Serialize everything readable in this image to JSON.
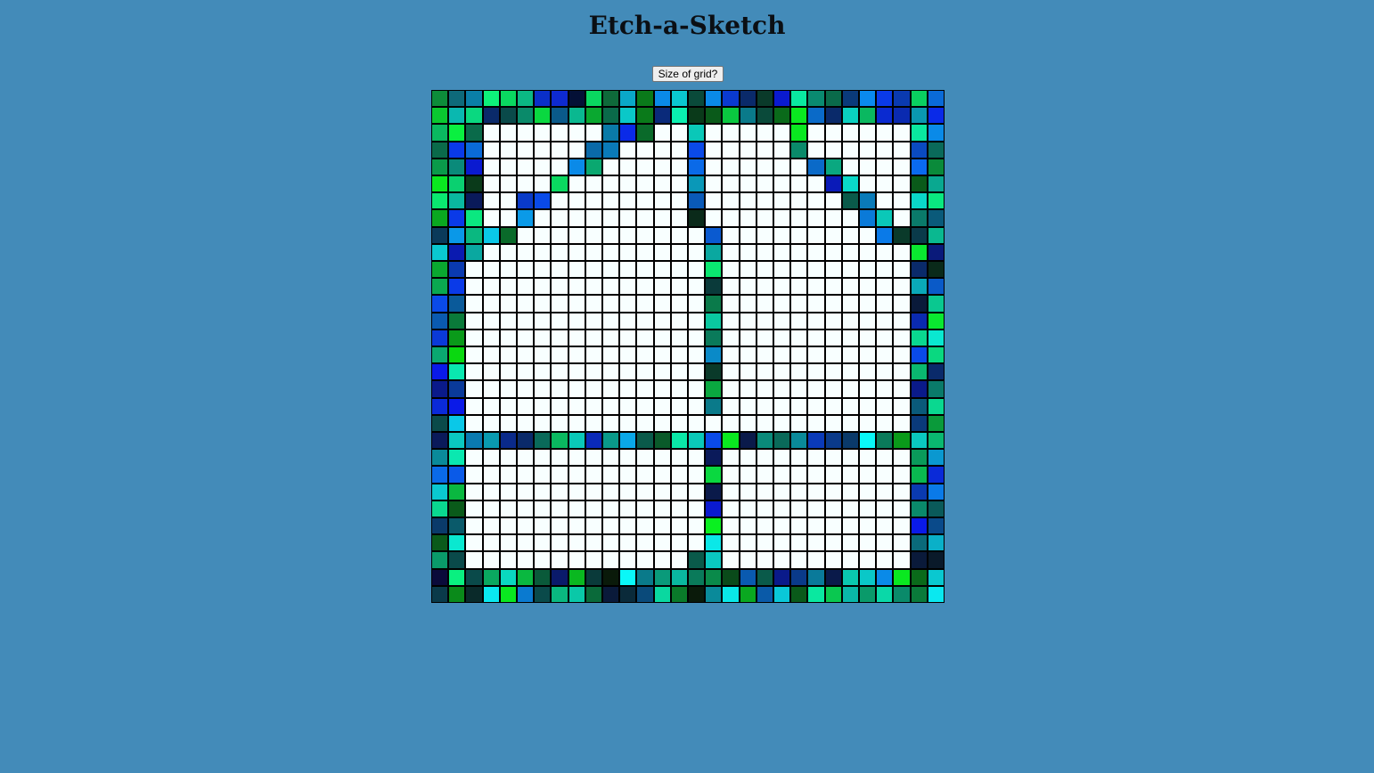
{
  "title": "Etch-a-Sketch",
  "controls": {
    "size_button_label": "Size of grid?"
  },
  "grid": {
    "size": 30,
    "blank_color": "#f8ffff",
    "colored_cells": {
      "0": [
        [
          0,
          "#0d8c3a"
        ],
        [
          1,
          "#0e6a7a"
        ],
        [
          2,
          "#0a7fa8"
        ],
        [
          3,
          "#0ef07a"
        ],
        [
          4,
          "#0ad860"
        ],
        [
          5,
          "#0bb884"
        ],
        [
          6,
          "#0a2fc8"
        ],
        [
          7,
          "#0e2ad0"
        ],
        [
          8,
          "#041036"
        ],
        [
          9,
          "#0ad860"
        ],
        [
          10,
          "#0e6a3a"
        ],
        [
          11,
          "#0aa8c8"
        ],
        [
          12,
          "#0a7a1a"
        ],
        [
          13,
          "#0a8ae8"
        ],
        [
          14,
          "#0ac8d0"
        ],
        [
          15,
          "#0a4a3a"
        ],
        [
          16,
          "#0a8ae8"
        ],
        [
          17,
          "#0a3ad0"
        ],
        [
          18,
          "#0a2a6a"
        ],
        [
          19,
          "#0a3a2a"
        ],
        [
          20,
          "#0a1ad0"
        ],
        [
          21,
          "#0ae8a0"
        ],
        [
          22,
          "#0a8a70"
        ],
        [
          23,
          "#0a6a4a"
        ],
        [
          24,
          "#0a3a7a"
        ],
        [
          25,
          "#0a8aee"
        ],
        [
          26,
          "#0a3ae8"
        ],
        [
          27,
          "#0a3ab0"
        ],
        [
          28,
          "#0ad060"
        ],
        [
          29,
          "#0a6ad8"
        ]
      ],
      "1": [
        [
          0,
          "#0ac830"
        ],
        [
          1,
          "#0ab8b0"
        ],
        [
          2,
          "#0ad880"
        ],
        [
          3,
          "#0a2a6a"
        ],
        [
          4,
          "#0a4a4a"
        ],
        [
          5,
          "#0a8a6a"
        ],
        [
          6,
          "#0ad840"
        ],
        [
          7,
          "#0a5a8a"
        ],
        [
          8,
          "#0ab890"
        ],
        [
          9,
          "#0aa830"
        ],
        [
          10,
          "#0a6a4a"
        ],
        [
          11,
          "#0ac8c8"
        ],
        [
          12,
          "#0a7a1a"
        ],
        [
          13,
          "#0a2a7a"
        ],
        [
          14,
          "#0af0b0"
        ],
        [
          15,
          "#0a3a1a"
        ],
        [
          16,
          "#0a5a1a"
        ],
        [
          17,
          "#0ac840"
        ],
        [
          18,
          "#0a7a8a"
        ],
        [
          19,
          "#0a4a3a"
        ],
        [
          20,
          "#0a6a1a"
        ],
        [
          21,
          "#0ae820"
        ],
        [
          22,
          "#0a6ac8"
        ],
        [
          23,
          "#0a2a6a"
        ],
        [
          24,
          "#0ad0c0"
        ],
        [
          25,
          "#0ab860"
        ],
        [
          26,
          "#0a2ad0"
        ],
        [
          27,
          "#0a2ab0"
        ],
        [
          28,
          "#0a98b0"
        ],
        [
          29,
          "#0a2ae8"
        ]
      ],
      "2": [
        [
          0,
          "#0ab860"
        ],
        [
          1,
          "#0af040"
        ],
        [
          2,
          "#0a6a4a"
        ],
        [
          10,
          "#0a7aa8"
        ],
        [
          11,
          "#0a2ae8"
        ],
        [
          12,
          "#0a6a2a"
        ],
        [
          15,
          "#0ac8b8"
        ],
        [
          21,
          "#0ae820"
        ],
        [
          28,
          "#0ae8a0"
        ],
        [
          29,
          "#0a8ae8"
        ]
      ],
      "3": [
        [
          0,
          "#0a6a4a"
        ],
        [
          1,
          "#0a3ae8"
        ],
        [
          2,
          "#0a6ad8"
        ],
        [
          9,
          "#0a6aa8"
        ],
        [
          10,
          "#0a7ab8"
        ],
        [
          15,
          "#0a4ae8"
        ],
        [
          21,
          "#0a8a6a"
        ],
        [
          28,
          "#0a4ac0"
        ],
        [
          29,
          "#0a6a5a"
        ]
      ],
      "4": [
        [
          0,
          "#0a9a4a"
        ],
        [
          1,
          "#0a8a7a"
        ],
        [
          2,
          "#0a1ad0"
        ],
        [
          8,
          "#0a8ae8"
        ],
        [
          9,
          "#0aa870"
        ],
        [
          15,
          "#0a6ae8"
        ],
        [
          22,
          "#0a6ac8"
        ],
        [
          23,
          "#0aa880"
        ],
        [
          28,
          "#0a6af0"
        ],
        [
          29,
          "#0a8a3a"
        ]
      ],
      "5": [
        [
          0,
          "#0ae820"
        ],
        [
          1,
          "#0ad070"
        ],
        [
          2,
          "#0a3a1a"
        ],
        [
          7,
          "#0ad860"
        ],
        [
          15,
          "#0a98b8"
        ],
        [
          23,
          "#0a1ab8"
        ],
        [
          24,
          "#0ad8c8"
        ],
        [
          28,
          "#0a5a1a"
        ],
        [
          29,
          "#0aa890"
        ]
      ],
      "6": [
        [
          0,
          "#0ae870"
        ],
        [
          1,
          "#0ab8a0"
        ],
        [
          2,
          "#0a1a5a"
        ],
        [
          5,
          "#0a3ac8"
        ],
        [
          6,
          "#0a4ae8"
        ],
        [
          15,
          "#0a5ab8"
        ],
        [
          24,
          "#0a5a4a"
        ],
        [
          25,
          "#0a7ab8"
        ],
        [
          28,
          "#0ad8c8"
        ],
        [
          29,
          "#0ae880"
        ]
      ],
      "7": [
        [
          0,
          "#0aa820"
        ],
        [
          1,
          "#0a3ae8"
        ],
        [
          2,
          "#0ae880"
        ],
        [
          5,
          "#0a9ae8"
        ],
        [
          15,
          "#0a2a1a"
        ],
        [
          25,
          "#0a7ad8"
        ],
        [
          26,
          "#0ac8b8"
        ],
        [
          28,
          "#0a7a6a"
        ],
        [
          29,
          "#0a5a7a"
        ]
      ],
      "8": [
        [
          0,
          "#0a3a5a"
        ],
        [
          1,
          "#0a98e8"
        ],
        [
          2,
          "#0ab880"
        ],
        [
          3,
          "#0ac8e8"
        ],
        [
          4,
          "#0a6a2a"
        ],
        [
          16,
          "#0a5ad0"
        ],
        [
          26,
          "#0a7ae8"
        ],
        [
          27,
          "#0a3a2a"
        ],
        [
          28,
          "#0a3a4a"
        ],
        [
          29,
          "#0ab890"
        ]
      ],
      "9": [
        [
          0,
          "#0ac8d0"
        ],
        [
          1,
          "#0a1ab0"
        ],
        [
          2,
          "#0aa8a0"
        ],
        [
          16,
          "#0aa8a0"
        ],
        [
          28,
          "#0ae830"
        ],
        [
          29,
          "#0a1a7a"
        ]
      ],
      "10": [
        [
          0,
          "#0aa830"
        ],
        [
          1,
          "#0a3ab0"
        ],
        [
          16,
          "#0ae870"
        ],
        [
          28,
          "#0a2a6a"
        ],
        [
          29,
          "#0a2a1a"
        ]
      ],
      "11": [
        [
          0,
          "#0aa850"
        ],
        [
          1,
          "#0a3ae8"
        ],
        [
          16,
          "#0a3a3a"
        ],
        [
          28,
          "#0aa8b8"
        ],
        [
          29,
          "#0a5ac8"
        ]
      ],
      "12": [
        [
          0,
          "#0a4ae8"
        ],
        [
          1,
          "#0a5a9a"
        ],
        [
          16,
          "#0a7a4a"
        ],
        [
          28,
          "#0a1a3a"
        ],
        [
          29,
          "#0ac890"
        ]
      ],
      "13": [
        [
          0,
          "#0a5ab0"
        ],
        [
          1,
          "#0a7a3a"
        ],
        [
          16,
          "#0ac8a0"
        ],
        [
          28,
          "#0a2ab0"
        ],
        [
          29,
          "#0ae830"
        ]
      ],
      "14": [
        [
          0,
          "#0a3ad8"
        ],
        [
          1,
          "#0a9a1a"
        ],
        [
          16,
          "#0a7a5a"
        ],
        [
          28,
          "#0ad890"
        ],
        [
          29,
          "#0ae8d0"
        ]
      ],
      "15": [
        [
          0,
          "#0aa870"
        ],
        [
          1,
          "#0ad810"
        ],
        [
          16,
          "#0a8ac8"
        ],
        [
          28,
          "#0a4ae8"
        ],
        [
          29,
          "#0ad880"
        ]
      ],
      "16": [
        [
          0,
          "#0a1ae8"
        ],
        [
          1,
          "#0ae8b0"
        ],
        [
          16,
          "#0a3a2a"
        ],
        [
          28,
          "#0ab870"
        ],
        [
          29,
          "#0a2a6a"
        ]
      ],
      "17": [
        [
          0,
          "#0a1a8a"
        ],
        [
          1,
          "#0a3a9a"
        ],
        [
          16,
          "#0aa840"
        ],
        [
          28,
          "#0a1a8a"
        ],
        [
          29,
          "#0a7a6a"
        ]
      ],
      "18": [
        [
          0,
          "#0a2ad8"
        ],
        [
          1,
          "#0a1ae8"
        ],
        [
          16,
          "#0a7a8a"
        ],
        [
          28,
          "#0a5a7a"
        ],
        [
          29,
          "#0ad890"
        ]
      ],
      "19": [
        [
          0,
          "#0a4a4a"
        ],
        [
          1,
          "#0ac8e8"
        ],
        [
          28,
          "#0a3a7a"
        ],
        [
          29,
          "#0a9a3a"
        ]
      ],
      "20": [
        [
          0,
          "#0a1a5a"
        ],
        [
          1,
          "#0ac8c0"
        ],
        [
          2,
          "#0a7ab0"
        ],
        [
          3,
          "#0a9ab0"
        ],
        [
          4,
          "#0a2a8a"
        ],
        [
          5,
          "#0a2a6a"
        ],
        [
          6,
          "#0a6a5a"
        ],
        [
          7,
          "#0ab860"
        ],
        [
          8,
          "#0ac8b8"
        ],
        [
          9,
          "#0a2ab8"
        ],
        [
          10,
          "#0a9a8a"
        ],
        [
          11,
          "#0aa8e8"
        ],
        [
          12,
          "#0a5a4a"
        ],
        [
          13,
          "#0a5a2a"
        ],
        [
          14,
          "#0ae8a8"
        ],
        [
          15,
          "#0ac8b8"
        ],
        [
          16,
          "#0a4ae8"
        ],
        [
          17,
          "#0ae820"
        ],
        [
          18,
          "#0a1a4a"
        ],
        [
          19,
          "#0a8a7a"
        ],
        [
          20,
          "#0a6a5a"
        ],
        [
          21,
          "#0a8a9a"
        ],
        [
          22,
          "#0a3ab8"
        ],
        [
          23,
          "#0a3a8a"
        ],
        [
          24,
          "#0a3a6a"
        ],
        [
          25,
          "#0af8f8"
        ],
        [
          26,
          "#0a7a5a"
        ],
        [
          27,
          "#0a9a1a"
        ],
        [
          28,
          "#0ac8c0"
        ],
        [
          29,
          "#0ab870"
        ]
      ],
      "21": [
        [
          0,
          "#0a8a9a"
        ],
        [
          1,
          "#0ae8b0"
        ],
        [
          16,
          "#0a1a5a"
        ],
        [
          28,
          "#0a9a5a"
        ],
        [
          29,
          "#0a98d0"
        ]
      ],
      "22": [
        [
          0,
          "#0a6ae8"
        ],
        [
          1,
          "#0a5ae8"
        ],
        [
          16,
          "#0ad840"
        ],
        [
          28,
          "#0ab850"
        ],
        [
          29,
          "#0a2ad8"
        ]
      ],
      "23": [
        [
          0,
          "#0ac8d0"
        ],
        [
          1,
          "#0ab840"
        ],
        [
          16,
          "#0a1a4a"
        ],
        [
          28,
          "#0a3ab0"
        ],
        [
          29,
          "#0a7ae8"
        ]
      ],
      "24": [
        [
          0,
          "#0ad890"
        ],
        [
          1,
          "#0a5a1a"
        ],
        [
          16,
          "#0a1ad0"
        ],
        [
          28,
          "#0a8a6a"
        ],
        [
          29,
          "#0a5a5a"
        ]
      ],
      "25": [
        [
          0,
          "#0a3a6a"
        ],
        [
          1,
          "#0a5a6a"
        ],
        [
          16,
          "#0af020"
        ],
        [
          28,
          "#0a1ae8"
        ],
        [
          29,
          "#0a4a8a"
        ]
      ],
      "26": [
        [
          0,
          "#0a5a1a"
        ],
        [
          1,
          "#0ae8d0"
        ],
        [
          16,
          "#0ae8e8"
        ],
        [
          28,
          "#0a6a7a"
        ],
        [
          29,
          "#0ab0c8"
        ]
      ],
      "27": [
        [
          0,
          "#0a9a6a"
        ],
        [
          1,
          "#0a4a4a"
        ],
        [
          15,
          "#0a5a4a"
        ],
        [
          16,
          "#0ac8c0"
        ],
        [
          28,
          "#0a1a3a"
        ],
        [
          29,
          "#0a1a2a"
        ]
      ],
      "28": [
        [
          0,
          "#0a0a3a"
        ],
        [
          1,
          "#0af080"
        ],
        [
          2,
          "#0a4a4a"
        ],
        [
          3,
          "#0aa860"
        ],
        [
          4,
          "#0ad8c0"
        ],
        [
          5,
          "#0ab840"
        ],
        [
          6,
          "#0a5a3a"
        ],
        [
          7,
          "#0a1a6a"
        ],
        [
          8,
          "#0ab820"
        ],
        [
          9,
          "#0a3a3a"
        ],
        [
          10,
          "#0a1a0a"
        ],
        [
          11,
          "#0af8f8"
        ],
        [
          12,
          "#0a7a8a"
        ],
        [
          13,
          "#0a9a7a"
        ],
        [
          14,
          "#0ab8a0"
        ],
        [
          15,
          "#0a7a5a"
        ],
        [
          16,
          "#0a8a4a"
        ],
        [
          17,
          "#0a4a1a"
        ],
        [
          18,
          "#0a5ab0"
        ],
        [
          19,
          "#0a5a4a"
        ],
        [
          20,
          "#0a1a8a"
        ],
        [
          21,
          "#0a3a8a"
        ],
        [
          22,
          "#0a7a9a"
        ],
        [
          23,
          "#0a1a4a"
        ],
        [
          24,
          "#0ac8b0"
        ],
        [
          25,
          "#0ac8c8"
        ],
        [
          26,
          "#0a8ae8"
        ],
        [
          27,
          "#0ae820"
        ],
        [
          28,
          "#0a6a1a"
        ],
        [
          29,
          "#0ac8d0"
        ]
      ],
      "29": [
        [
          0,
          "#0a3a4a"
        ],
        [
          1,
          "#0a8a1a"
        ],
        [
          2,
          "#0a2a2a"
        ],
        [
          3,
          "#0ae8f0"
        ],
        [
          4,
          "#0ae820"
        ],
        [
          5,
          "#0a7ad0"
        ],
        [
          6,
          "#0a4a4a"
        ],
        [
          7,
          "#0ab880"
        ],
        [
          8,
          "#0ac8a8"
        ],
        [
          9,
          "#0a6a3a"
        ],
        [
          10,
          "#0a1a3a"
        ],
        [
          11,
          "#0a2a3a"
        ],
        [
          12,
          "#0a4a7a"
        ],
        [
          13,
          "#0ad8a0"
        ],
        [
          14,
          "#0a7a2a"
        ],
        [
          15,
          "#0a1a0a"
        ],
        [
          16,
          "#0a8a9a"
        ],
        [
          17,
          "#0ae8e8"
        ],
        [
          18,
          "#0aa820"
        ],
        [
          19,
          "#0a5aa8"
        ],
        [
          20,
          "#0ac8d8"
        ],
        [
          21,
          "#0a5a1a"
        ],
        [
          22,
          "#0ae8a0"
        ],
        [
          23,
          "#0ac850"
        ],
        [
          24,
          "#0ab8a8"
        ],
        [
          25,
          "#0a9a6a"
        ],
        [
          26,
          "#0ad8a8"
        ],
        [
          27,
          "#0a8a6a"
        ],
        [
          28,
          "#0a7a3a"
        ],
        [
          29,
          "#0ae8f0"
        ]
      ]
    }
  }
}
